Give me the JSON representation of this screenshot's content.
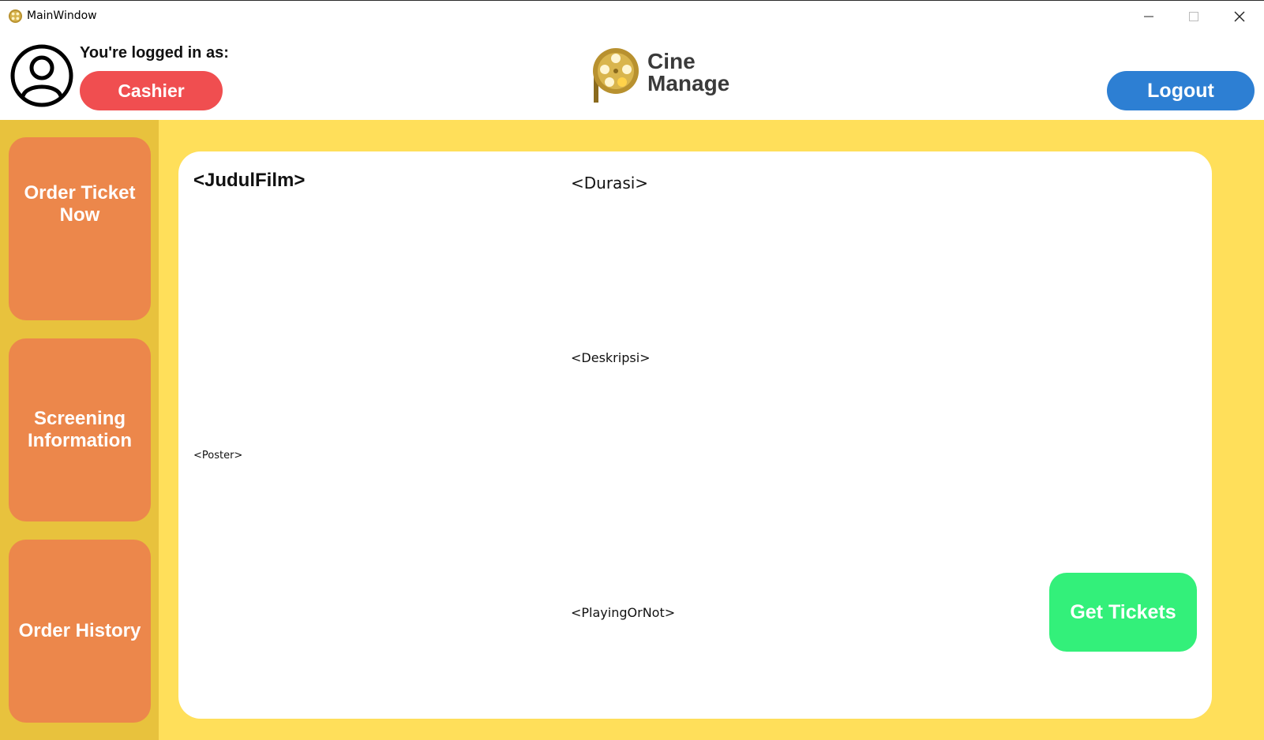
{
  "window": {
    "title": "MainWindow",
    "controls": {
      "minimize": "minimize-icon",
      "maximize": "maximize-icon",
      "close": "close-icon"
    }
  },
  "header": {
    "logged_in_label": "You're logged in as:",
    "role": "Cashier",
    "brand_line1": "Cine",
    "brand_line2": "Manage",
    "logout_label": "Logout",
    "colors": {
      "role_badge": "#f04e50",
      "logout": "#2d7fd3"
    }
  },
  "sidebar": {
    "items": [
      {
        "label": "Order Ticket Now"
      },
      {
        "label": "Screening Information"
      },
      {
        "label": "Order History"
      }
    ],
    "colors": {
      "background": "#e8c23d",
      "button": "#ec874b"
    }
  },
  "main": {
    "film_title": "<JudulFilm>",
    "duration": "<Durasi>",
    "description": "<Deskripsi>",
    "poster": "<Poster>",
    "playing_status": "<PlayingOrNot>",
    "get_tickets_label": "Get Tickets",
    "colors": {
      "background": "#ffdf5a",
      "card": "#ffffff",
      "get_tickets": "#33f07a"
    }
  }
}
